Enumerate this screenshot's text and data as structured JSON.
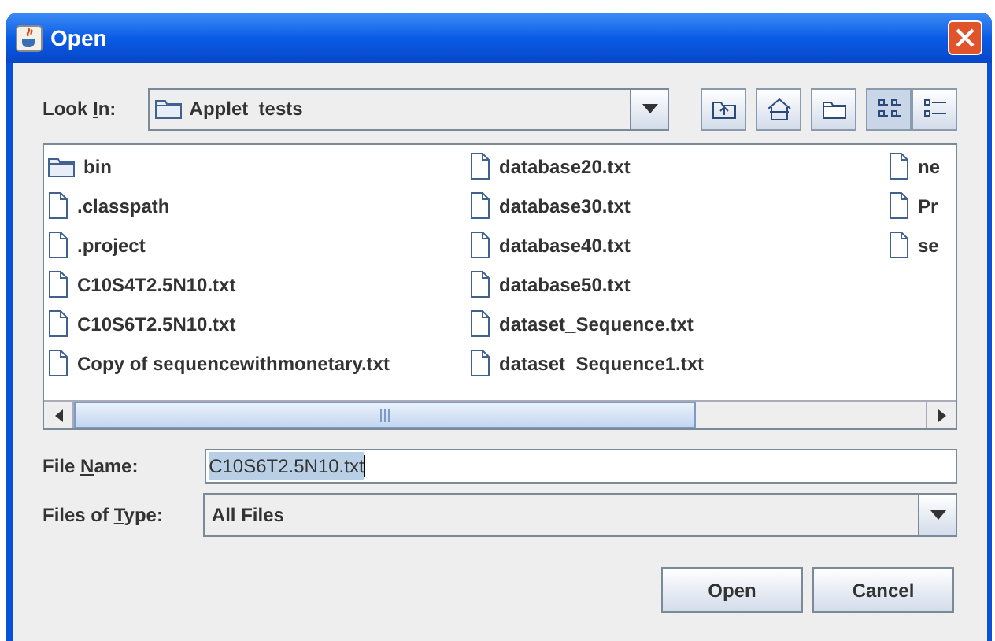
{
  "window": {
    "title": "Open"
  },
  "look_in": {
    "label_parts": [
      "Look ",
      "I",
      "n:"
    ],
    "value": "Applet_tests"
  },
  "toolbar": [
    {
      "kind": "up",
      "selected": false
    },
    {
      "kind": "home",
      "selected": false
    },
    {
      "kind": "new_folder",
      "selected": false
    },
    {
      "kind": "list",
      "selected": true
    },
    {
      "kind": "details",
      "selected": false
    }
  ],
  "file_columns": [
    [
      {
        "name": "bin",
        "kind": "folder"
      },
      {
        "name": ".classpath",
        "kind": "file"
      },
      {
        "name": ".project",
        "kind": "file"
      },
      {
        "name": "C10S4T2.5N10.txt",
        "kind": "file"
      },
      {
        "name": "C10S6T2.5N10.txt",
        "kind": "file"
      },
      {
        "name": "Copy of sequencewithmonetary.txt",
        "kind": "file"
      }
    ],
    [
      {
        "name": "database20.txt",
        "kind": "file"
      },
      {
        "name": "database30.txt",
        "kind": "file"
      },
      {
        "name": "database40.txt",
        "kind": "file"
      },
      {
        "name": "database50.txt",
        "kind": "file"
      },
      {
        "name": "dataset_Sequence.txt",
        "kind": "file"
      },
      {
        "name": "dataset_Sequence1.txt",
        "kind": "file"
      }
    ],
    [
      {
        "name": "ne",
        "kind": "file"
      },
      {
        "name": "Pr",
        "kind": "file"
      },
      {
        "name": "se",
        "kind": "file"
      }
    ]
  ],
  "file_name": {
    "label_parts": [
      "File ",
      "N",
      "ame:"
    ],
    "value": "C10S6T2.5N10.txt",
    "text_selected": true
  },
  "file_type": {
    "label_parts": [
      "Files of ",
      "T",
      "ype:"
    ],
    "value": "All Files"
  },
  "buttons": [
    "Open",
    "Cancel"
  ]
}
